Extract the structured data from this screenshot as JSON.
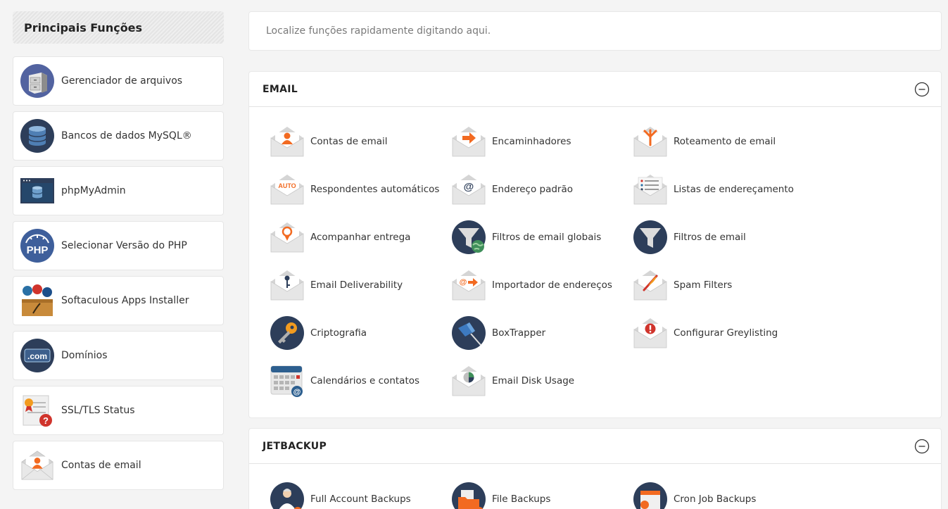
{
  "sidebar": {
    "title": "Principais Funções",
    "items": [
      {
        "label": "Gerenciador de arquivos",
        "icon": "file-cabinet-icon"
      },
      {
        "label": "Bancos de dados MySQL®",
        "icon": "database-icon"
      },
      {
        "label": "phpMyAdmin",
        "icon": "phpmyadmin-icon"
      },
      {
        "label": "Selecionar Versão do PHP",
        "icon": "php-icon"
      },
      {
        "label": "Softaculous Apps Installer",
        "icon": "softaculous-icon"
      },
      {
        "label": "Domínios",
        "icon": "dotcom-icon"
      },
      {
        "label": "SSL/TLS Status",
        "icon": "certificate-icon"
      },
      {
        "label": "Contas de email",
        "icon": "email-account-icon"
      }
    ]
  },
  "search": {
    "placeholder": "Localize funções rapidamente digitando aqui."
  },
  "email": {
    "title": "EMAIL",
    "items": [
      {
        "label": "Contas de email"
      },
      {
        "label": "Encaminhadores"
      },
      {
        "label": "Roteamento de email"
      },
      {
        "label": "Respondentes automáticos",
        "badge": "AUTO"
      },
      {
        "label": "Endereço padrão",
        "badge": "@"
      },
      {
        "label": "Listas de endereçamento"
      },
      {
        "label": "Acompanhar entrega"
      },
      {
        "label": "Filtros de email globais"
      },
      {
        "label": "Filtros de email"
      },
      {
        "label": "Email Deliverability"
      },
      {
        "label": "Importador de endereços"
      },
      {
        "label": "Spam Filters"
      },
      {
        "label": "Criptografia"
      },
      {
        "label": "BoxTrapper"
      },
      {
        "label": "Configurar Greylisting"
      },
      {
        "label": "Calendários e contatos"
      },
      {
        "label": "Email Disk Usage"
      }
    ]
  },
  "jetbackup": {
    "title": "JETBACKUP",
    "items": [
      {
        "label": "Full Account Backups"
      },
      {
        "label": "File Backups"
      },
      {
        "label": "Cron Job Backups"
      }
    ]
  },
  "colors": {
    "accent_orange": "#f26a21",
    "navy": "#2d3e5a",
    "envelope_grey": "#d9d9d9"
  }
}
